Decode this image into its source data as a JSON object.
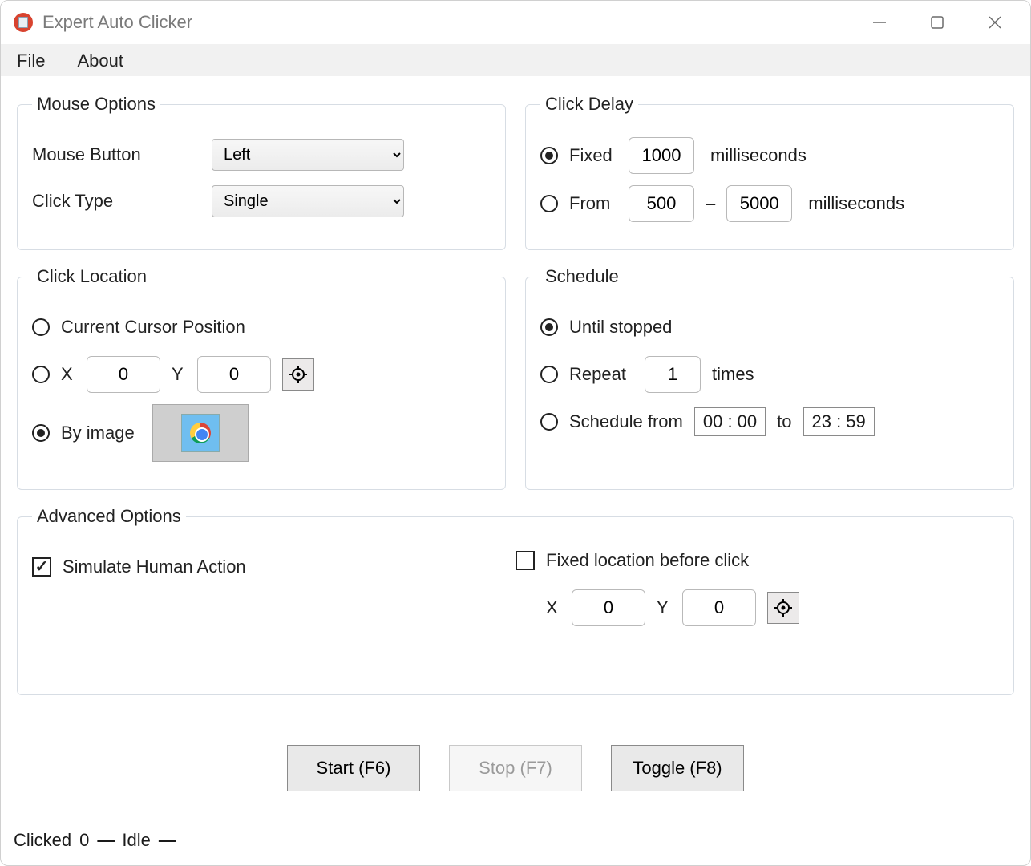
{
  "window": {
    "title": "Expert Auto Clicker"
  },
  "menubar": {
    "file": "File",
    "about": "About"
  },
  "mouse_options": {
    "legend": "Mouse Options",
    "mouse_button_label": "Mouse Button",
    "mouse_button_value": "Left",
    "click_type_label": "Click Type",
    "click_type_value": "Single"
  },
  "click_delay": {
    "legend": "Click Delay",
    "fixed_label": "Fixed",
    "fixed_value": "1000",
    "fixed_unit": "milliseconds",
    "from_label": "From",
    "from_value": "500",
    "range_sep": "–",
    "to_value": "5000",
    "range_unit": "milliseconds"
  },
  "click_location": {
    "legend": "Click Location",
    "current_label": "Current Cursor Position",
    "x_label": "X",
    "x_value": "0",
    "y_label": "Y",
    "y_value": "0",
    "by_image_label": "By image"
  },
  "schedule": {
    "legend": "Schedule",
    "until_label": "Until stopped",
    "repeat_label": "Repeat",
    "repeat_value": "1",
    "repeat_unit": "times",
    "schedule_from_label": "Schedule from",
    "time_from": "00 : 00",
    "to_label": "to",
    "time_to": "23 : 59"
  },
  "advanced": {
    "legend": "Advanced Options",
    "simulate_label": "Simulate Human Action",
    "fixed_location_label": "Fixed location before click",
    "x_label": "X",
    "x_value": "0",
    "y_label": "Y",
    "y_value": "0"
  },
  "buttons": {
    "start": "Start (F6)",
    "stop": "Stop (F7)",
    "toggle": "Toggle (F8)"
  },
  "status": {
    "clicked_label": "Clicked",
    "clicked_value": "0",
    "sep": "—",
    "state": "Idle"
  }
}
